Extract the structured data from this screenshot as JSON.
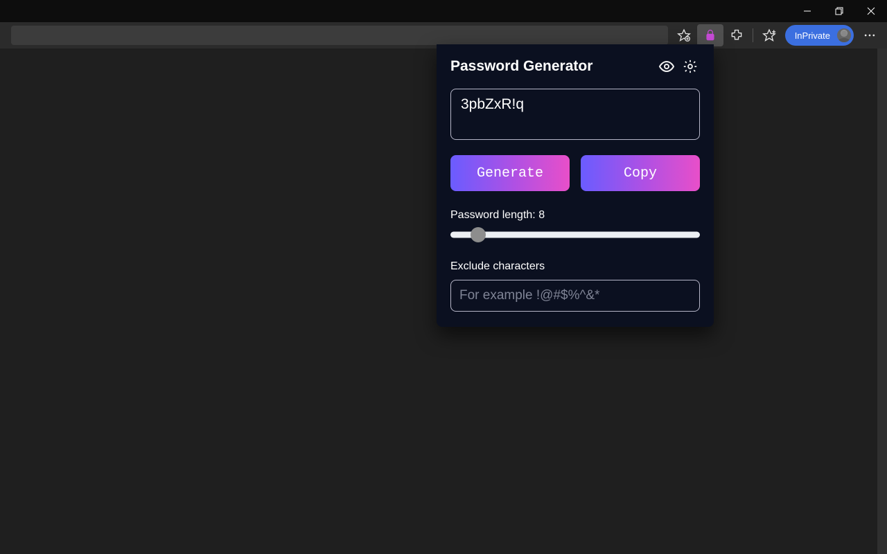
{
  "window": {
    "minimize_name": "minimize",
    "restore_name": "restore",
    "close_name": "close"
  },
  "toolbar": {
    "inprivate_label": "InPrivate"
  },
  "popup": {
    "title": "Password Generator",
    "password_value": "3pbZxR!q",
    "generate_label": "Generate",
    "copy_label": "Copy",
    "length_label_prefix": "Password length: ",
    "length_value": "8",
    "slider_min": 4,
    "slider_max": 64,
    "exclude_label": "Exclude characters",
    "exclude_placeholder": "For example !@#$%^&*"
  }
}
